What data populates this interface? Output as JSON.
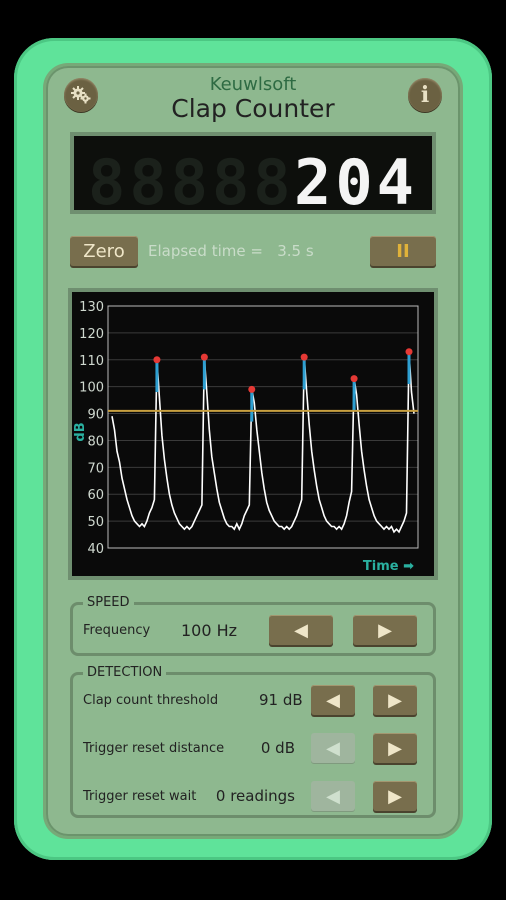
{
  "header": {
    "brand": "Keuwlsoft",
    "title": "Clap Counter",
    "settings_icon": "gear-icon",
    "info_label": "i"
  },
  "display": {
    "ghost": "88888",
    "count": "204"
  },
  "controls": {
    "zero_label": "Zero",
    "elapsed_text": "Elapsed time =   3.5 s",
    "pause_label": "II"
  },
  "chart_data": {
    "type": "line",
    "ylabel": "dB",
    "xlabel": "Time",
    "x_arrow": "➡",
    "yticks": [
      "130",
      "120",
      "110",
      "100",
      "90",
      "80",
      "70",
      "60",
      "50",
      "40"
    ],
    "ylim": [
      40,
      130
    ],
    "threshold": 91,
    "threshold_color": "#c8a040",
    "line_color": "#ffffff",
    "peak_color": "#e53935",
    "spike_color": "#2e9fd1",
    "values": [
      89,
      84,
      76,
      72,
      66,
      62,
      58,
      55,
      52,
      50,
      49,
      48,
      49,
      48,
      50,
      53,
      55,
      58,
      110,
      96,
      82,
      73,
      66,
      60,
      56,
      53,
      51,
      49,
      48,
      47,
      48,
      47,
      48,
      50,
      52,
      54,
      56,
      111,
      98,
      84,
      74,
      68,
      62,
      57,
      54,
      51,
      49,
      48,
      48,
      47,
      49,
      47,
      49,
      52,
      54,
      56,
      99,
      94,
      84,
      76,
      68,
      62,
      57,
      54,
      52,
      50,
      49,
      48,
      48,
      47,
      48,
      47,
      48,
      50,
      52,
      55,
      58,
      111,
      98,
      86,
      76,
      69,
      63,
      58,
      55,
      52,
      50,
      49,
      48,
      48,
      47,
      48,
      47,
      49,
      52,
      57,
      61,
      103,
      97,
      86,
      76,
      69,
      63,
      58,
      55,
      52,
      50,
      49,
      48,
      47,
      48,
      47,
      48,
      46,
      47,
      46,
      48,
      50,
      53,
      113,
      98,
      90
    ],
    "peaks": [
      {
        "i": 18,
        "v": 110
      },
      {
        "i": 37,
        "v": 111
      },
      {
        "i": 56,
        "v": 99
      },
      {
        "i": 77,
        "v": 111
      },
      {
        "i": 97,
        "v": 103
      },
      {
        "i": 119,
        "v": 113
      }
    ]
  },
  "speed": {
    "title": "SPEED",
    "frequency_label": "Frequency",
    "frequency_value": "100 Hz"
  },
  "detection": {
    "title": "DETECTION",
    "rows": [
      {
        "label": "Clap count threshold",
        "value": "91 dB"
      },
      {
        "label": "Trigger reset distance",
        "value": "0 dB"
      },
      {
        "label": "Trigger reset wait",
        "value": "0 readings"
      }
    ]
  },
  "arrows": {
    "left": "◀",
    "right": "▶"
  }
}
